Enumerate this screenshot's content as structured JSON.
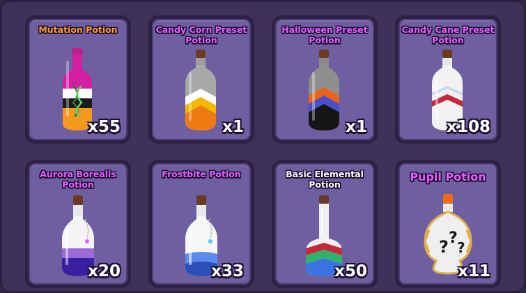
{
  "inventory": {
    "items": [
      {
        "name": "Mutation Potion",
        "name_color": "#ff9a2e",
        "quantity": "x55",
        "icon": "mutation-potion-icon"
      },
      {
        "name": "Candy Corn Preset Potion",
        "name_color": "#e85cff",
        "quantity": "x1",
        "icon": "candy-corn-potion-icon"
      },
      {
        "name": "Halloween Preset Potion",
        "name_color": "#e85cff",
        "quantity": "x1",
        "icon": "halloween-potion-icon"
      },
      {
        "name": "Candy Cane Preset Potion",
        "name_color": "#e85cff",
        "quantity": "x108",
        "icon": "candy-cane-potion-icon"
      },
      {
        "name": "Aurora Borealis Potion",
        "name_color": "#e85cff",
        "quantity": "x20",
        "icon": "aurora-borealis-potion-icon"
      },
      {
        "name": "Frostbite Potion",
        "name_color": "#e85cff",
        "quantity": "x33",
        "icon": "frostbite-potion-icon"
      },
      {
        "name": "Basic Elemental Potion",
        "name_color": "#ffffff",
        "quantity": "x50",
        "icon": "basic-elemental-potion-icon"
      },
      {
        "name": "Pupil Potion",
        "name_color": "#e85cff",
        "quantity": "x11",
        "icon": "pupil-potion-icon"
      }
    ]
  }
}
